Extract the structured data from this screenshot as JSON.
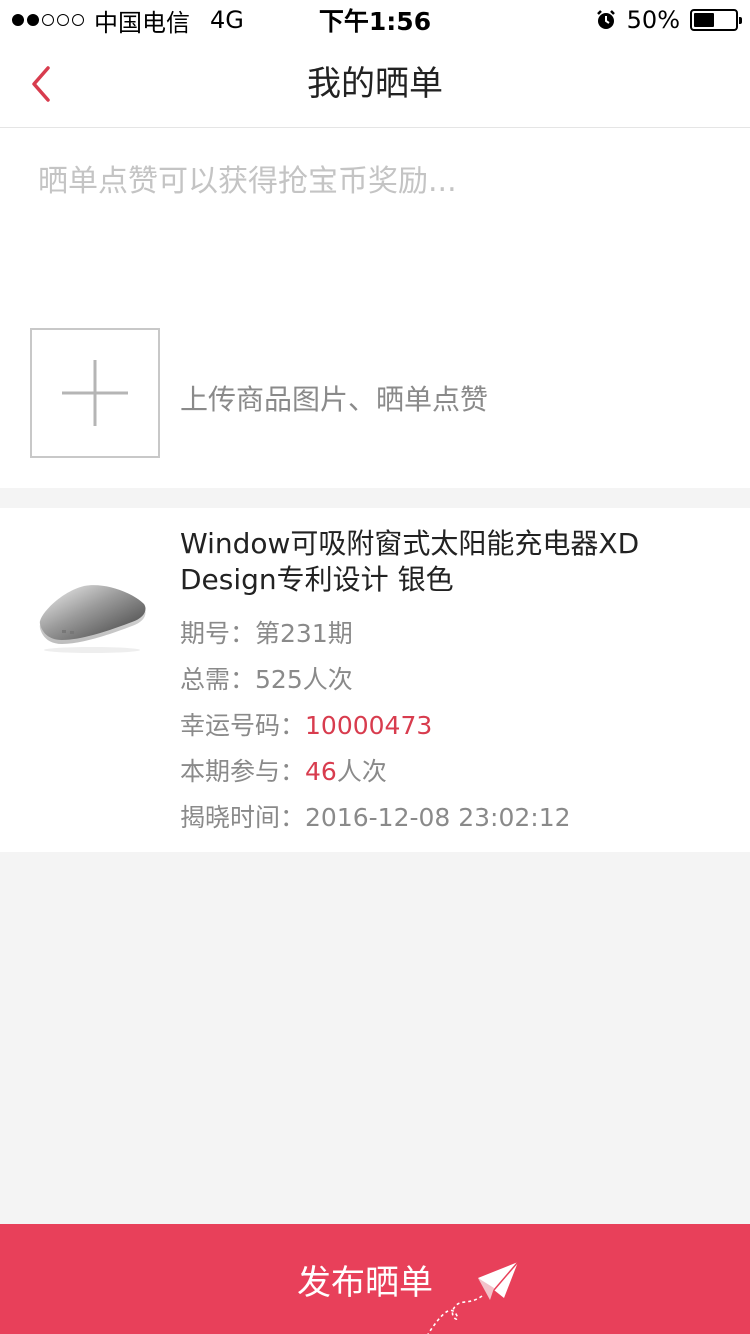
{
  "status_bar": {
    "carrier": "中国电信",
    "network": "4G",
    "time": "下午1:56",
    "battery": "50%",
    "battery_level": 0.5,
    "signal_bars": 2
  },
  "nav": {
    "title": "我的晒单",
    "back_icon": "chevron-left-icon"
  },
  "compose": {
    "placeholder": "晒单点赞可以获得抢宝币奖励...",
    "value": "",
    "upload_hint": "上传商品图片、晒单点赞",
    "upload_icon": "plus-icon"
  },
  "product": {
    "title": "Window可吸附窗式太阳能充电器XD Design专利设计 银色",
    "issue_label": "期号：",
    "issue_value": "第231期",
    "total_label": "总需：",
    "total_value": "525人次",
    "lucky_label": "幸运号码：",
    "lucky_value": "10000473",
    "participate_label": "本期参与：",
    "participate_value": "46",
    "participate_unit": "人次",
    "reveal_label": "揭晓时间：",
    "reveal_value": "2016-12-08 23:02:12"
  },
  "publish": {
    "label": "发布晒单",
    "icon": "paper-plane-icon"
  },
  "colors": {
    "accent": "#e8405a",
    "highlight": "#d83c4e"
  }
}
